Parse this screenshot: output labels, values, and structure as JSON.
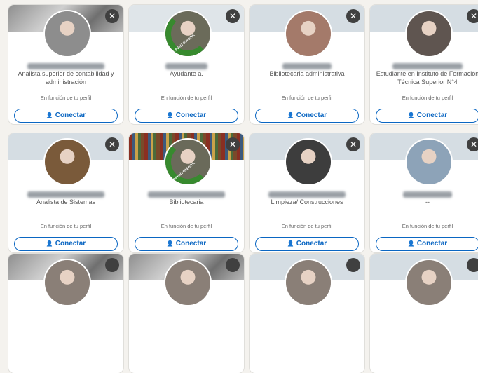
{
  "colors": {
    "accent": "#0a66c2",
    "open_to_work": "#378a2e"
  },
  "cards": [
    {
      "banner": "b-photo",
      "avatar": "#8d8d8d",
      "open_to_work": false,
      "headline": "Analista superior de contabilidad y administración",
      "context": "En función de tu perfil",
      "connect_label": "Conectar",
      "dismiss_icon": "✕"
    },
    {
      "banner": "b-light",
      "avatar": "#6b6b5a",
      "open_to_work": true,
      "headline": "Ayudante a.",
      "context": "En función de tu perfil",
      "connect_label": "Conectar",
      "dismiss_icon": "✕"
    },
    {
      "banner": "b-gray",
      "avatar": "#a47a6a",
      "open_to_work": false,
      "headline": "Bibliotecaria administrativa",
      "context": "En función de tu perfil",
      "connect_label": "Conectar",
      "dismiss_icon": "✕"
    },
    {
      "banner": "b-gray",
      "avatar": "#5f5550",
      "open_to_work": false,
      "headline": "Estudiante en Instituto de Formación Técnica Superior N°4",
      "context": "En función de tu perfil",
      "connect_label": "Conectar",
      "dismiss_icon": "✕"
    },
    {
      "banner": "b-gray",
      "avatar": "#7a5a3a",
      "open_to_work": false,
      "headline": "Analista de Sistemas",
      "context": "En función de tu perfil",
      "connect_label": "Conectar",
      "dismiss_icon": "✕"
    },
    {
      "banner": "b-shelf",
      "avatar": "#6a6a5a",
      "open_to_work": true,
      "headline": "Bibliotecaria",
      "context": "En función de tu perfil",
      "connect_label": "Conectar",
      "dismiss_icon": "✕"
    },
    {
      "banner": "b-gray",
      "avatar": "#3d3d3d",
      "open_to_work": false,
      "headline": "Limpieza/ Construcciones",
      "context": "En función de tu perfil",
      "connect_label": "Conectar",
      "dismiss_icon": "✕"
    },
    {
      "banner": "b-gray",
      "avatar": "#8da3b8",
      "open_to_work": false,
      "headline": "--",
      "context": "En función de tu perfil",
      "connect_label": "Conectar",
      "dismiss_icon": "✕"
    }
  ]
}
